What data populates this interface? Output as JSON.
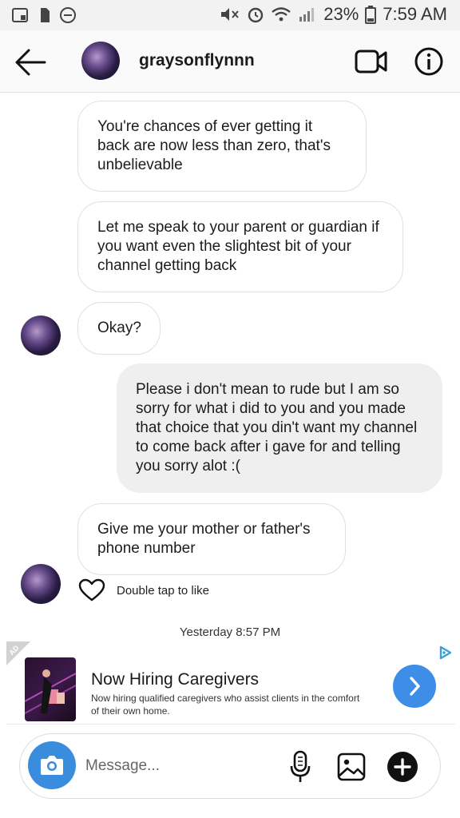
{
  "status_bar": {
    "battery_pct": "23%",
    "time": "7:59 AM"
  },
  "header": {
    "username": "graysonflynnn"
  },
  "messages": [
    {
      "direction": "incoming",
      "text": "You're chances of ever getting it back are now less than zero, that's unbelievable"
    },
    {
      "direction": "incoming",
      "text": "Let me speak to your parent or guardian if you want even the slightest bit of your channel getting back"
    },
    {
      "direction": "incoming",
      "text": "Okay?"
    },
    {
      "direction": "outgoing",
      "text": "Please i don't mean to rude but I am so sorry for what i did to you and you made that choice that you din't want my channel to come back after i gave for and telling you sorry alot :("
    },
    {
      "direction": "incoming",
      "text": "Give me your mother or father's phone number"
    }
  ],
  "like_hint": "Double tap to like",
  "timestamp": "Yesterday 8:57 PM",
  "ad": {
    "badge": "AD",
    "title": "Now Hiring Caregivers",
    "description": "Now hiring qualified caregivers who assist clients in the comfort of their own home."
  },
  "composer": {
    "placeholder": "Message..."
  },
  "colors": {
    "accent_blue": "#3e8ee8",
    "camera_blue": "#3a8ddd",
    "outgoing_bubble": "#efefef",
    "incoming_border": "#e0e0e0"
  },
  "icons": [
    "status-icons",
    "back-arrow-icon",
    "video-call-icon",
    "info-icon",
    "heart-icon",
    "chevron-right-icon",
    "ad-choices-icon",
    "camera-icon",
    "microphone-icon",
    "gallery-icon",
    "plus-icon"
  ]
}
